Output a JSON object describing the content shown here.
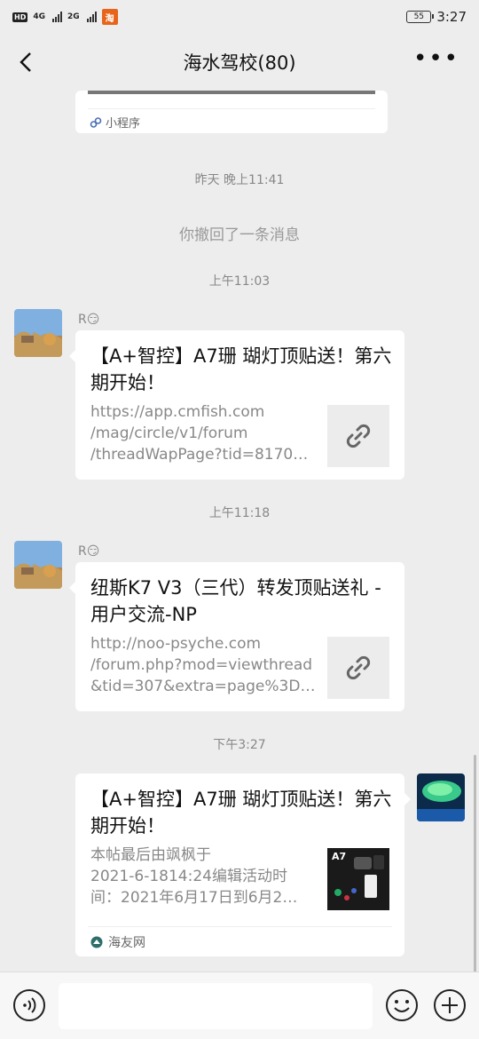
{
  "status": {
    "network1": "4G",
    "network2": "2G",
    "hd": "HD",
    "battery": "55",
    "time": "3:27",
    "notification": "淘"
  },
  "header": {
    "title": "海水驾校(80)"
  },
  "top_card": {
    "tag": "小程序"
  },
  "messages": {
    "time1": "昨天 晚上11:41",
    "recall": "你撤回了一条消息",
    "time2": "上午11:03",
    "msg1": {
      "sender": "R😏",
      "title": "【A+智控】A7珊 瑚灯顶贴送！第六期开始！",
      "desc_lines": [
        "https://app.cmfish.com",
        "/mag/circle/v1/forum",
        "/threadWapPage?tid=8170…"
      ]
    },
    "time3": "上午11:18",
    "msg2": {
      "sender": "R😏",
      "title": "纽斯K7 V3（三代）转发顶贴送礼 - 用户交流-NP",
      "desc_lines": [
        "http://noo-psyche.com",
        "/forum.php?mod=viewthread",
        "&tid=307&extra=page%3D…"
      ]
    },
    "time4": "下午3:27",
    "msg3": {
      "title": "【A+智控】A7珊 瑚灯顶贴送！第六期开始！",
      "desc_lines": [
        "本帖最后由飒枫于",
        "2021-6-1814:24编辑活动时",
        "间：2021年6月17日到6月2…"
      ],
      "thumb_label": "A7",
      "source": "海友网"
    }
  },
  "colors": {
    "bg": "#ededed",
    "card": "#ffffff",
    "muted": "#888888"
  }
}
